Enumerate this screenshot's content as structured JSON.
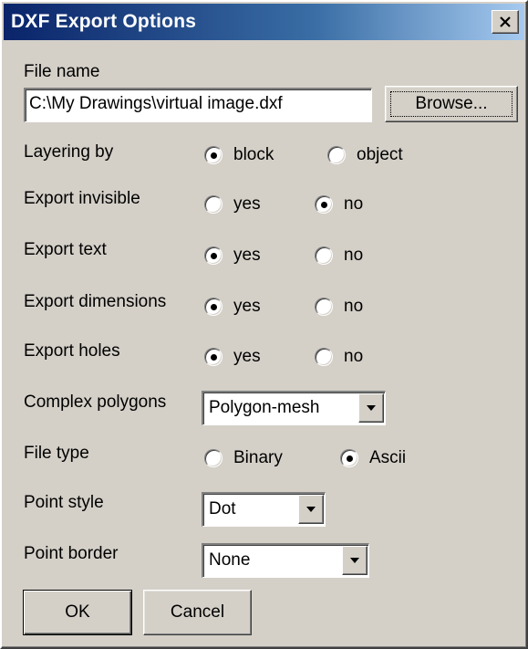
{
  "window": {
    "title": "DXF Export Options"
  },
  "file": {
    "label": "File name",
    "value": "C:\\My Drawings\\virtual image.dxf",
    "browse_label": "Browse..."
  },
  "layering": {
    "label": "Layering by",
    "options": [
      "block",
      "object"
    ],
    "selected": "block"
  },
  "export_invisible": {
    "label": "Export invisible",
    "options": [
      "yes",
      "no"
    ],
    "selected": "no"
  },
  "export_text": {
    "label": "Export text",
    "options": [
      "yes",
      "no"
    ],
    "selected": "yes"
  },
  "export_dimensions": {
    "label": "Export dimensions",
    "options": [
      "yes",
      "no"
    ],
    "selected": "yes"
  },
  "export_holes": {
    "label": "Export holes",
    "options": [
      "yes",
      "no"
    ],
    "selected": "yes"
  },
  "complex_polygons": {
    "label": "Complex polygons",
    "value": "Polygon-mesh"
  },
  "file_type": {
    "label": "File type",
    "options": [
      "Binary",
      "Ascii"
    ],
    "selected": "Ascii"
  },
  "point_style": {
    "label": "Point style",
    "value": "Dot"
  },
  "point_border": {
    "label": "Point border",
    "value": "None"
  },
  "buttons": {
    "ok": "OK",
    "cancel": "Cancel"
  },
  "icons": {
    "close": "close-icon",
    "dropdown": "chevron-down-icon"
  },
  "colors": {
    "titlebar_start": "#0a246a",
    "titlebar_end": "#a6caf0",
    "face": "#d4d0c8"
  }
}
